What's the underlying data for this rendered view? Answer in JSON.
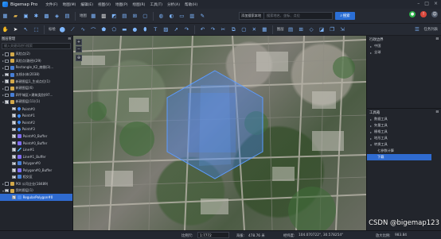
{
  "app": {
    "title": "Bigemap Pro"
  },
  "menu": [
    "文件(F)",
    "地图(M)",
    "编辑(E)",
    "视图(V)",
    "地图(P)",
    "绘图(R)",
    "工具(T)",
    "分析(A)",
    "帮助(H)"
  ],
  "toolbar1": {
    "map_label": "地图"
  },
  "search": {
    "type": "添加搜索本地",
    "placeholder": "搜索地名、坐标、点位",
    "button": "搜索"
  },
  "toolbar2": {
    "annotate_label": "标绘",
    "layer_label": "图层",
    "task_label": "任务列表"
  },
  "layer_panel": {
    "title": "图层管理",
    "search_placeholder": "输入关键词进行搜索",
    "layers": [
      {
        "label": "风险点(2)",
        "icon": "folder-icon",
        "checked": false,
        "depth": 0,
        "expander": "▸"
      },
      {
        "label": "风险点(路径)(29)",
        "icon": "folder-icon",
        "checked": false,
        "depth": 0,
        "expander": "▸"
      },
      {
        "label": "Rectangle_K2_商圈(3)...",
        "icon": "poly-icon",
        "checked": false,
        "depth": 0,
        "expander": "▸"
      },
      {
        "label": "五线水体(2038)",
        "icon": "poly-icon",
        "checked": true,
        "depth": 0,
        "expander": "▸"
      },
      {
        "label": "新建图层1_生成点位(1)",
        "icon": "folder-icon",
        "checked": true,
        "depth": 0,
        "expander": "▸"
      },
      {
        "label": "新建图层(6)",
        "icon": "folder-icon",
        "checked": false,
        "depth": 0,
        "expander": "▸"
      },
      {
        "label": "四平城区+建筑类别(97...",
        "icon": "poly-icon",
        "checked": false,
        "depth": 0,
        "expander": "▸"
      },
      {
        "label": "新建图层(11)(1)",
        "icon": "folder-icon",
        "checked": true,
        "depth": 0,
        "expander": "▾"
      },
      {
        "label": "Point#0",
        "icon": "point-icon",
        "checked": true,
        "depth": 1,
        "expander": ""
      },
      {
        "label": "Point#1",
        "icon": "point-icon",
        "checked": true,
        "depth": 1,
        "expander": ""
      },
      {
        "label": "Point#2",
        "icon": "point-icon",
        "checked": true,
        "depth": 1,
        "expander": ""
      },
      {
        "label": "Point#3",
        "icon": "point-icon",
        "checked": true,
        "depth": 1,
        "expander": ""
      },
      {
        "label": "Point#0_Buffer",
        "icon": "buffer-icon",
        "checked": true,
        "depth": 1,
        "expander": ""
      },
      {
        "label": "Point#0_Buffer",
        "icon": "buffer-icon",
        "checked": true,
        "depth": 1,
        "expander": ""
      },
      {
        "label": "Line#1",
        "icon": "line-icon",
        "checked": true,
        "depth": 1,
        "expander": ""
      },
      {
        "label": "Line#1_Buffer",
        "icon": "buffer-icon",
        "checked": true,
        "depth": 1,
        "expander": ""
      },
      {
        "label": "Polygon#0",
        "icon": "poly-icon",
        "checked": true,
        "depth": 1,
        "expander": ""
      },
      {
        "label": "Polygon#0_Buffer",
        "icon": "buffer-icon",
        "checked": true,
        "depth": 1,
        "expander": ""
      },
      {
        "label": "相交区",
        "icon": "poly-icon",
        "checked": true,
        "depth": 1,
        "expander": ""
      },
      {
        "label": "POI 公司企业(18489)",
        "icon": "folder-icon",
        "checked": false,
        "depth": 0,
        "expander": "▸"
      },
      {
        "label": "我的图层(1)",
        "icon": "folder-icon",
        "checked": true,
        "depth": 0,
        "expander": "▾"
      },
      {
        "label": "RegularPolygon#0",
        "icon": "poly-icon",
        "checked": true,
        "depth": 1,
        "expander": "",
        "selected": true
      }
    ]
  },
  "admin_panel": {
    "title": "行政边界",
    "items": [
      {
        "label": "中国",
        "expander": "▸"
      },
      {
        "label": "全球",
        "expander": "▸"
      }
    ]
  },
  "toolbox_panel": {
    "title": "工具箱",
    "items": [
      {
        "label": "数据工具",
        "expander": "▸",
        "child": false,
        "active": false
      },
      {
        "label": "矢量工具",
        "expander": "▸",
        "child": false,
        "active": false
      },
      {
        "label": "栅格工具",
        "expander": "▸",
        "child": false,
        "active": false
      },
      {
        "label": "地形工具",
        "expander": "▸",
        "child": false,
        "active": false
      },
      {
        "label": "转换工具",
        "expander": "▾",
        "child": false,
        "active": false
      },
      {
        "label": "七参数计算",
        "expander": "",
        "child": true,
        "active": false
      },
      {
        "label": "下载",
        "expander": "",
        "child": true,
        "active": true
      }
    ]
  },
  "statusbar": {
    "scale_label": "比例尺:",
    "scale_value": "1:7772",
    "elev_label": "海拔:",
    "elev_value": "478.76 米",
    "coord_label": "经纬度:",
    "coord_value": "104.070722°, 30.578254°",
    "zoom_label": "放大比例:",
    "zoom_value": "983.84"
  },
  "watermark": "CSDN @bigemap123",
  "colors": {
    "accent": "#2f6bd0",
    "panel": "#22252c",
    "selection_fill": "#3f84ff"
  }
}
